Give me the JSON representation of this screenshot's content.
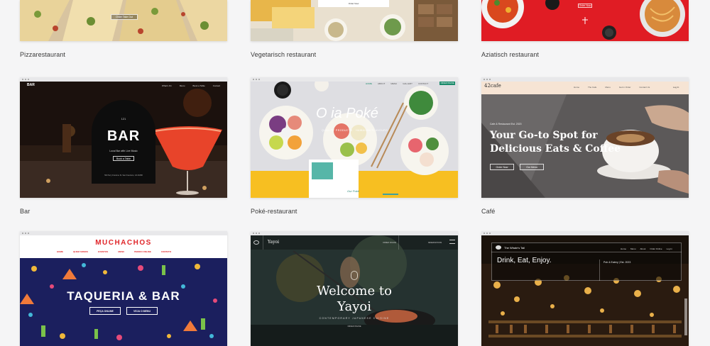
{
  "templates": [
    {
      "label": "Pizzarestaurant",
      "preview": {
        "button": "Order Take Out"
      }
    },
    {
      "label": "Vegetarisch restaurant",
      "preview": {
        "button": "Order Now"
      }
    },
    {
      "label": "Aziatisch restaurant",
      "preview": {
        "button": "Order Now"
      }
    },
    {
      "label": "Bar",
      "preview": {
        "logo": "BAR",
        "nav": [
          "What's On",
          "Menu",
          "Book a Table",
          "Contact"
        ],
        "number": "121",
        "title": "BAR",
        "subtitle": "Local Bar with Live Music",
        "button": "Book a Table",
        "footer": "500 Terry Francine St. San Francisco, CA 94158"
      }
    },
    {
      "label": "Poké-restaurant",
      "preview": {
        "title": "O ia Poké",
        "tagline": "QUALITY PRODUCTS · HAWAIIAN FLAVOURS",
        "nav": [
          "HOME",
          "ABOUT",
          "MENU",
          "GALLERY",
          "CONTACT"
        ],
        "order": "ORDER ONLINE",
        "card": "Our Poké"
      }
    },
    {
      "label": "Café",
      "preview": {
        "logo": "42cafe",
        "nav": [
          "Home",
          "The Cafe",
          "Menu",
          "Get in Order",
          "Contact Us"
        ],
        "login": "Log In",
        "eyebrow": "Cafe & Restaurant Est. 2020",
        "title_line1": "Your Go-to Spot for",
        "title_line2": "Delicious Eats & Coffee",
        "button1": "Order Now",
        "button2": "Our Menu"
      }
    },
    {
      "label": "",
      "preview": {
        "title": "MUCHACHOS",
        "nav": [
          "HOME",
          "QUEM SOMOS",
          "EVENTOS",
          "MENU",
          "PEDIDO ONLINE",
          "CONTATO"
        ],
        "headline": "TAQUERIA & BAR",
        "button1": "PEÇA ONLINE",
        "button2": "VEJA O MENU"
      }
    },
    {
      "label": "",
      "preview": {
        "logo": "Yayoi",
        "nav": [
          "ORDER ONLINE",
          "RESERVATIONS"
        ],
        "title_line1": "Welcome to",
        "title_line2": "Yayoi",
        "subtitle": "CONTEMPORARY JAPANESE CUISINE",
        "button": "ORDER ONLINE"
      }
    },
    {
      "label": "",
      "preview": {
        "logo": "The Whale's Tail",
        "nav": [
          "Home",
          "Menu",
          "About",
          "Order Online",
          "Log In"
        ],
        "title": "Drink, Eat, Enjoy.",
        "subtitle": "Pub & Eatery | Est. 2023"
      }
    }
  ]
}
